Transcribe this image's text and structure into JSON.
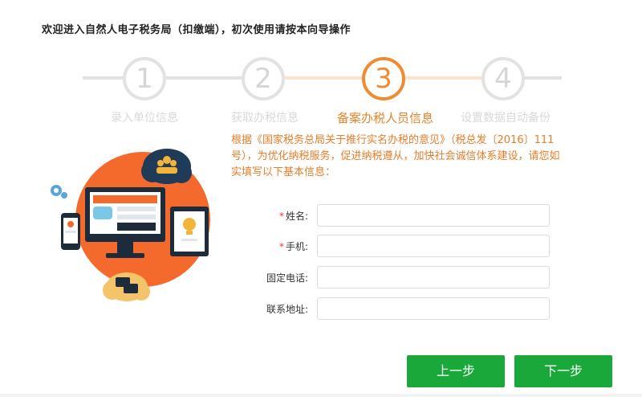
{
  "header": {
    "title": "欢迎进入自然人电子税务局（扣缴端），初次使用请按本向导操作"
  },
  "steps": [
    {
      "number": "1",
      "label": "录入单位信息"
    },
    {
      "number": "2",
      "label": "获取办税信息"
    },
    {
      "number": "3",
      "label": "备案办税人员信息"
    },
    {
      "number": "4",
      "label": "设置数据自动备份"
    }
  ],
  "active_step": 3,
  "notice": "根据《国家税务总局关于推行实名办税的意见》（税总发〔2016〕111号），为优化纳税服务，促进纳税遵从，加快社会诚信体系建设，请您如实填写以下基本信息：",
  "form": {
    "name_label": "姓名:",
    "phone_label": "手机:",
    "tel_label": "固定电话:",
    "address_label": "联系地址:",
    "required_mark": "*",
    "name_value": "",
    "phone_value": "",
    "tel_value": "",
    "address_value": ""
  },
  "buttons": {
    "prev": "上一步",
    "next": "下一步"
  },
  "colors": {
    "accent": "#f08c2e",
    "button": "#1aa83a",
    "inactive": "#d6d6d6"
  },
  "illustration": {
    "icons": [
      "gear-icon",
      "users-cloud-icon",
      "monitor-icon",
      "phone-icon",
      "tablet-icon",
      "lightbulb-icon",
      "chat-cloud-icon"
    ]
  }
}
